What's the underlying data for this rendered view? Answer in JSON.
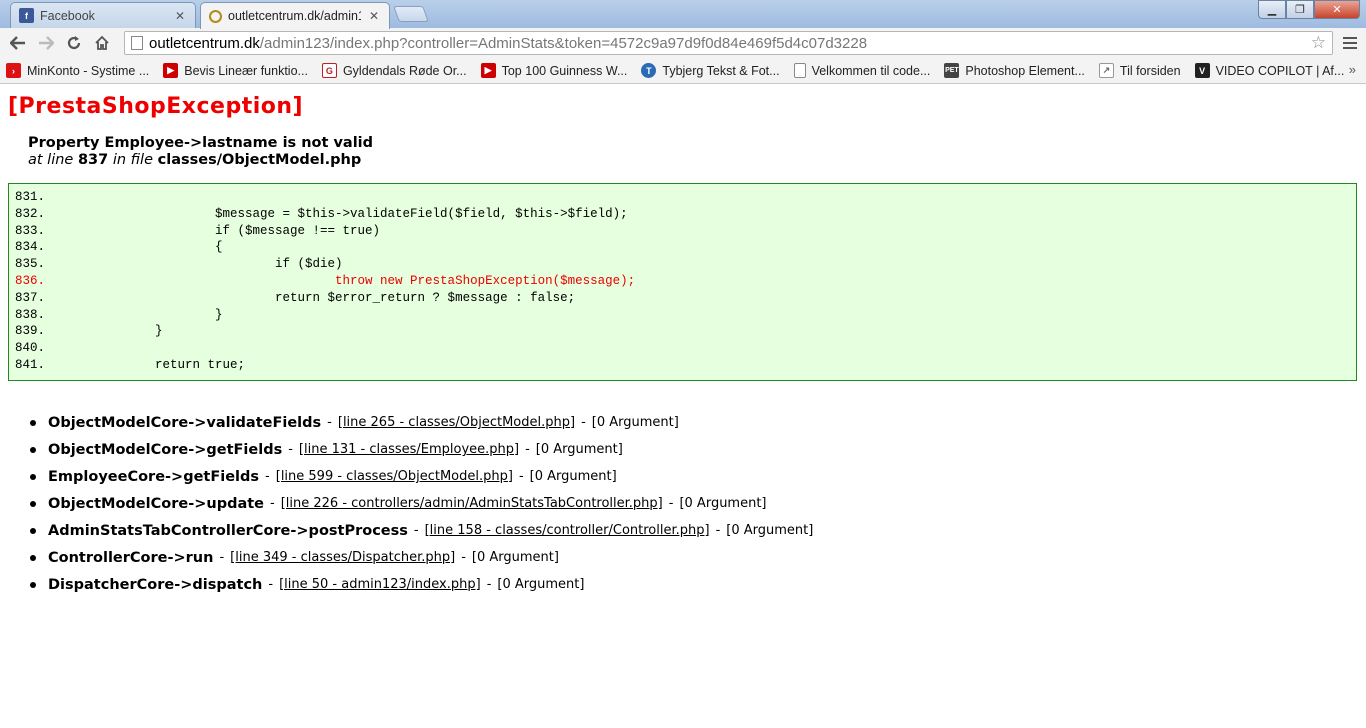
{
  "browser": {
    "tabs": [
      {
        "label": "Facebook",
        "active": false,
        "icon": "facebook-icon"
      },
      {
        "label": "outletcentrum.dk/admin1",
        "active": true,
        "icon": "prestashop-icon"
      }
    ],
    "url_host": "outletcentrum.dk",
    "url_path": "/admin123/index.php?controller=AdminStats&token=4572c9a97d9f0d84e469f5d4c07d3228",
    "bookmarks": [
      {
        "label": "MinKonto - Systime ...",
        "icon_color": "#d11",
        "icon": "systime-icon"
      },
      {
        "label": "Bevis Lineær funktio...",
        "icon_color": "#c00",
        "icon": "youtube-icon"
      },
      {
        "label": "Gyldendals Røde Or...",
        "icon_color": "#b22",
        "icon": "gyldendal-icon"
      },
      {
        "label": "Top 100 Guinness W...",
        "icon_color": "#c00",
        "icon": "youtube-icon"
      },
      {
        "label": "Tybjerg Tekst & Fot...",
        "icon_color": "#2a6bb8",
        "icon": "tybjerg-icon"
      },
      {
        "label": "Velkommen til code...",
        "icon_color": "#ffffff",
        "icon": "page-icon"
      },
      {
        "label": "Photoshop Element...",
        "icon_color": "#444",
        "icon": "pet-icon"
      },
      {
        "label": "Til forsiden",
        "icon_color": "#666",
        "icon": "til-forsiden-icon"
      },
      {
        "label": "VIDEO COPILOT | Af...",
        "icon_color": "#222",
        "icon": "videocopilot-icon"
      }
    ],
    "bookmarks_more": "»"
  },
  "exception": {
    "title": "[PrestaShopException]",
    "message": "Property Employee->lastname is not valid",
    "at_line_prefix": "at line",
    "line": "837",
    "in_file_prefix": "in file",
    "file": "classes/ObjectModel.php"
  },
  "code": [
    {
      "ln": "831.",
      "text": "",
      "highlight": false
    },
    {
      "ln": "832.",
      "text": "                    $message = $this->validateField($field, $this->$field);",
      "highlight": false
    },
    {
      "ln": "833.",
      "text": "                    if ($message !== true)",
      "highlight": false
    },
    {
      "ln": "834.",
      "text": "                    {",
      "highlight": false
    },
    {
      "ln": "835.",
      "text": "                            if ($die)",
      "highlight": false
    },
    {
      "ln": "836.",
      "text": "                                    throw new PrestaShopException($message);",
      "highlight": true
    },
    {
      "ln": "837.",
      "text": "                            return $error_return ? $message : false;",
      "highlight": false
    },
    {
      "ln": "838.",
      "text": "                    }",
      "highlight": false
    },
    {
      "ln": "839.",
      "text": "            }",
      "highlight": false
    },
    {
      "ln": "840.",
      "text": "",
      "highlight": false
    },
    {
      "ln": "841.",
      "text": "            return true;",
      "highlight": false
    }
  ],
  "stack_trace": [
    {
      "fn": "ObjectModelCore->validateFields",
      "file": "[line 265 - classes/ObjectModel.php]",
      "args": "[0 Argument]"
    },
    {
      "fn": "ObjectModelCore->getFields",
      "file": "[line 131 - classes/Employee.php]",
      "args": "[0 Argument]"
    },
    {
      "fn": "EmployeeCore->getFields",
      "file": "[line 599 - classes/ObjectModel.php]",
      "args": "[0 Argument]"
    },
    {
      "fn": "ObjectModelCore->update",
      "file": "[line 226 - controllers/admin/AdminStatsTabController.php]",
      "args": "[0 Argument]"
    },
    {
      "fn": "AdminStatsTabControllerCore->postProcess",
      "file": "[line 158 - classes/controller/Controller.php]",
      "args": "[0 Argument]"
    },
    {
      "fn": "ControllerCore->run",
      "file": "[line 349 - classes/Dispatcher.php]",
      "args": "[0 Argument]"
    },
    {
      "fn": "DispatcherCore->dispatch",
      "file": "[line 50 - admin123/index.php]",
      "args": "[0 Argument]"
    }
  ],
  "colors": {
    "error_red": "#ee0000",
    "code_bg": "#e5ffdf",
    "code_border": "#1f8a1f"
  }
}
